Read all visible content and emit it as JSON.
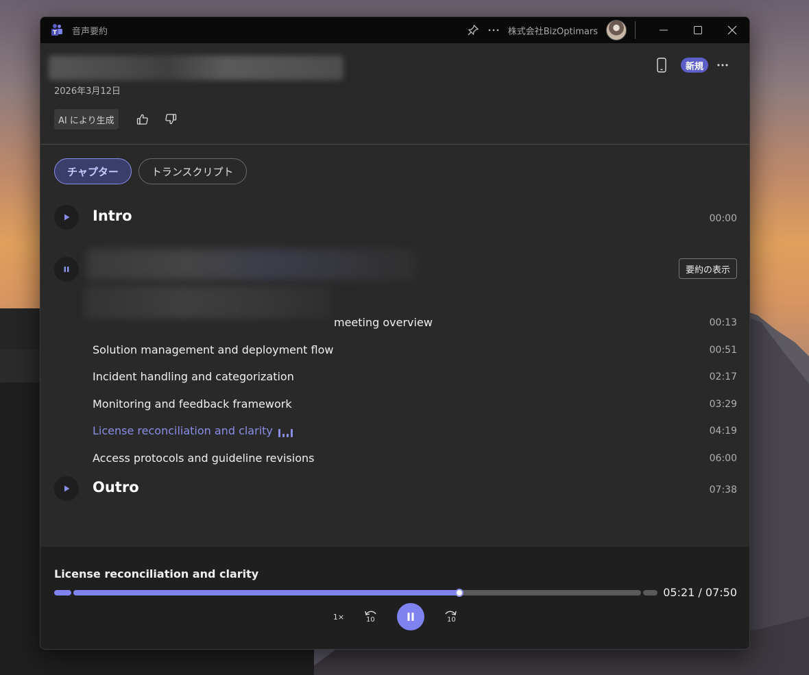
{
  "window": {
    "title": "音声要約",
    "org_name": "株式会社BizOptimars"
  },
  "header": {
    "date": "2026年3月12日",
    "ai_badge": "AI により生成",
    "new_badge": "新規"
  },
  "tabs": [
    {
      "label": "チャプター",
      "active": true
    },
    {
      "label": "トランスクリプト",
      "active": false
    }
  ],
  "chapters": {
    "intro": {
      "title": "Intro",
      "time": "00:00"
    },
    "main": {
      "summary_button": "要約の表示",
      "items": [
        {
          "label": "meeting overview",
          "time": "00:13",
          "active": false
        },
        {
          "label": "Solution management and deployment flow",
          "time": "00:51",
          "active": false
        },
        {
          "label": "Incident handling and categorization",
          "time": "02:17",
          "active": false
        },
        {
          "label": "Monitoring and feedback framework",
          "time": "03:29",
          "active": false
        },
        {
          "label": "License reconciliation and clarity",
          "time": "04:19",
          "active": true
        },
        {
          "label": "Access protocols and guideline revisions",
          "time": "06:00",
          "active": false
        }
      ]
    },
    "outro": {
      "title": "Outro",
      "time": "07:38"
    }
  },
  "player": {
    "now_playing": "License reconciliation and clarity",
    "time_readout": "05:21 / 07:50",
    "progress_fraction": 0.68,
    "speed_label": "1×",
    "skip_back_label": "10",
    "skip_forward_label": "10"
  },
  "colors": {
    "accent": "#7f83f0",
    "accent_text": "#8b8ee6",
    "badge": "#5b5fc7"
  }
}
